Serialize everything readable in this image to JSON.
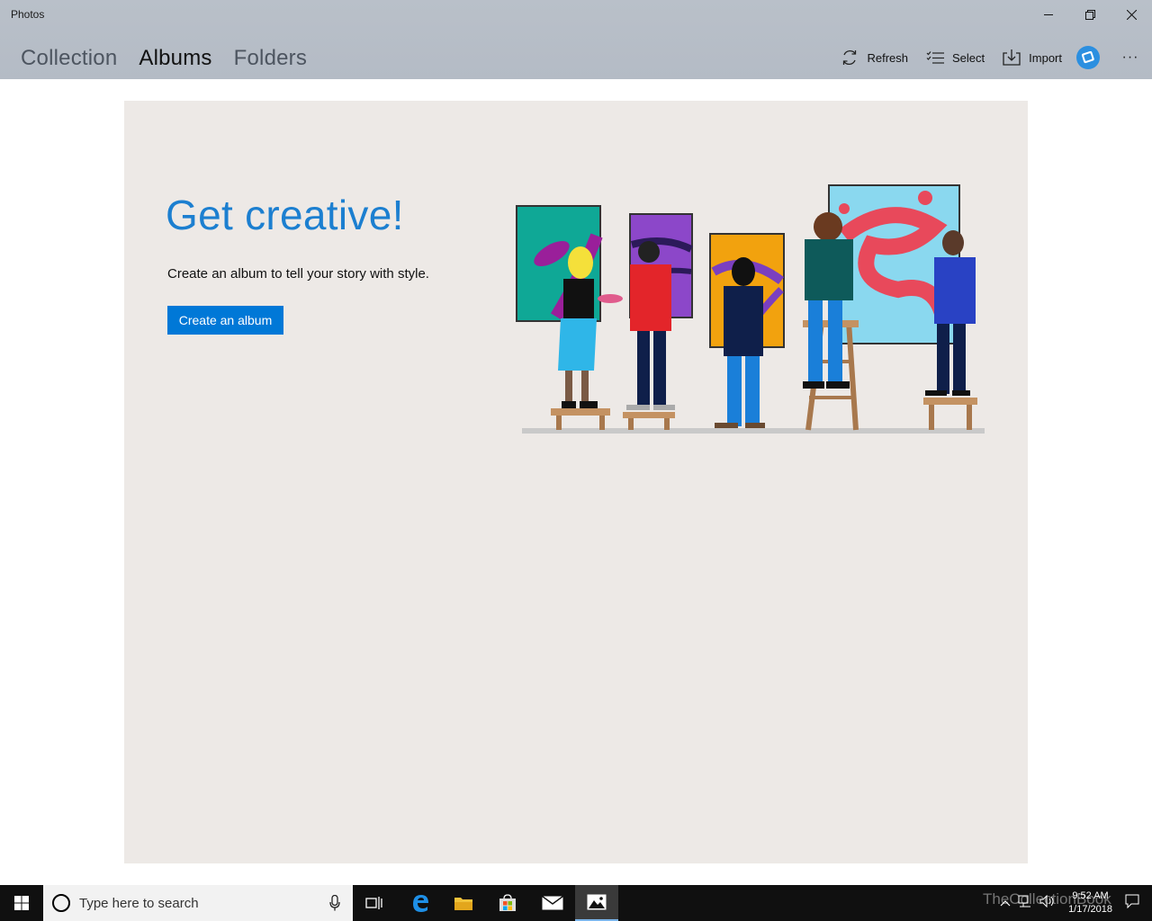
{
  "window": {
    "title": "Photos"
  },
  "nav": {
    "tabs": [
      {
        "label": "Collection"
      },
      {
        "label": "Albums"
      },
      {
        "label": "Folders"
      }
    ]
  },
  "toolbar": {
    "refresh_label": "Refresh",
    "select_label": "Select",
    "import_label": "Import",
    "more_label": "···"
  },
  "main": {
    "headline": "Get creative!",
    "subtext": "Create an album to tell your story with style.",
    "cta_label": "Create an album"
  },
  "taskbar": {
    "search_placeholder": "Type here to search",
    "time": "9:52 AM",
    "date": "1/17/2018",
    "watermark": "TheCollectionBook"
  },
  "colors": {
    "accent": "#0078d7",
    "headline": "#1c7fd0",
    "panel": "#ede9e6",
    "appbar": "#b7bec8"
  },
  "icons": [
    "minimize-icon",
    "restore-icon",
    "close-icon",
    "refresh-icon",
    "select-icon",
    "import-icon",
    "account-icon",
    "windows-logo-icon",
    "cortana-icon",
    "microphone-icon",
    "task-view-icon",
    "edge-icon",
    "file-explorer-icon",
    "store-icon",
    "mail-icon",
    "photos-icon"
  ]
}
